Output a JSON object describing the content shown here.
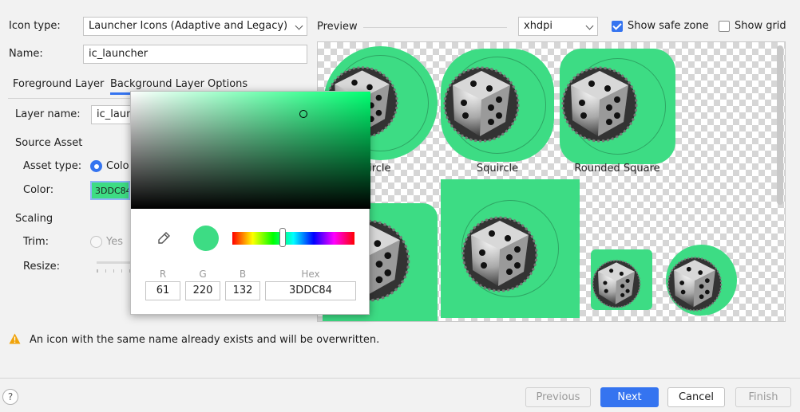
{
  "form": {
    "icon_type_label": "Icon type:",
    "icon_type_value": "Launcher Icons (Adaptive and Legacy)",
    "name_label": "Name:",
    "name_value": "ic_launcher"
  },
  "tabs": [
    "Foreground Layer",
    "Background Layer",
    "Options"
  ],
  "layer": {
    "layer_name_label": "Layer name:",
    "layer_name_value": "ic_laun",
    "source_asset": "Source Asset",
    "asset_type_label": "Asset type:",
    "asset_type_option": "Colo",
    "color_label": "Color:",
    "color_value": "3DDC84",
    "scaling": "Scaling",
    "trim_label": "Trim:",
    "trim_option": "Yes",
    "resize_label": "Resize:"
  },
  "preview": {
    "label": "Preview",
    "density": "xhdpi",
    "show_safe_zone": "Show safe zone",
    "show_safe_zone_checked": true,
    "show_grid": "Show grid",
    "show_grid_checked": false,
    "shapes": [
      "Circle",
      "Squircle",
      "Rounded Square"
    ]
  },
  "color_picker": {
    "r_label": "R",
    "g_label": "G",
    "b_label": "B",
    "hex_label": "Hex",
    "r": "61",
    "g": "220",
    "b": "132",
    "hex": "3DDC84",
    "hue_fraction": 0.41,
    "sv_saturation": 0.72,
    "sv_value": 0.86
  },
  "warning": "An icon with the same name already exists and will be overwritten.",
  "buttons": {
    "previous": "Previous",
    "next": "Next",
    "cancel": "Cancel",
    "finish": "Finish",
    "help": "?"
  },
  "colors": {
    "accent": "#3574f0",
    "background_color": "#3ddc84",
    "warning": "#f0a30a"
  }
}
